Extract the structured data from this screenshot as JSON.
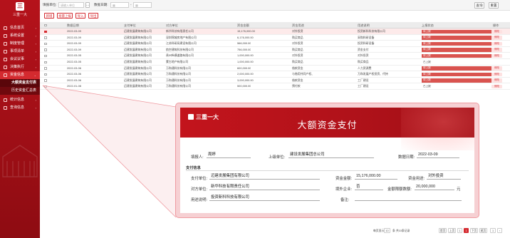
{
  "app": {
    "logo_mark": "三",
    "logo_text": "三重一大"
  },
  "sidebar": {
    "items": [
      {
        "label": "信息首页",
        "icon": "home-icon"
      },
      {
        "label": "系统设置",
        "icon": "settings-icon"
      },
      {
        "label": "制度管理",
        "icon": "document-icon"
      },
      {
        "label": "事项清单",
        "icon": "list-icon"
      },
      {
        "label": "会议议事",
        "icon": "meeting-icon"
      },
      {
        "label": "决策执行",
        "icon": "execute-icon"
      },
      {
        "label": "资金信息",
        "icon": "money-icon"
      }
    ],
    "subitems": [
      {
        "label": "大额资金支付表"
      },
      {
        "label": "历史资金汇总表"
      }
    ],
    "items_after": [
      {
        "label": "统计信息",
        "icon": "chart-icon"
      },
      {
        "label": "查询信息",
        "icon": "query-icon"
      }
    ]
  },
  "search": {
    "org_label": "填报单位:",
    "org_placeholder": "请输入单位",
    "date_label": "数据日期:",
    "date_separator": "-",
    "query_button": "查询",
    "reset_button": "重置"
  },
  "actions": {
    "add": "新增",
    "batch_submit": "批量上报",
    "import": "导入",
    "export": "导出"
  },
  "table": {
    "headers": [
      "",
      "数据日期",
      "支付单位",
      "对方单位",
      "资金金额",
      "资金用途",
      "用途说明",
      "上报状态",
      "操作"
    ],
    "rows": [
      {
        "date": "2022-03-09",
        "payer": "迈建发展建筑有限公司",
        "payee": "新华科技有限责任公司",
        "amount": "15,176,000.00",
        "purpose": "对外投资",
        "desc": "投资新科科技有限公司",
        "status": "待上报",
        "op": "修改",
        "selected": true
      },
      {
        "date": "2022-03-09",
        "payer": "迈建发展建筑有限公司",
        "payee": "深圳锦城房地产有限公司",
        "amount": "6,176,000.00",
        "purpose": "购买商品",
        "desc": "采购科研设备",
        "status": "待上报",
        "op": "修改",
        "selected": false
      },
      {
        "date": "2022-03-09",
        "payer": "迈建发展建筑有限公司",
        "payee": "江苏科研局建设有限公司",
        "amount": "566,000.00",
        "purpose": "对外投资",
        "desc": "投资科研设备",
        "status": "待上报",
        "op": "修改",
        "selected": false
      },
      {
        "date": "2022-03-09",
        "payer": "迈建发展建筑有限公司",
        "payee": "航空建筑科技有限公司",
        "amount": "756,000.00",
        "purpose": "购买商品",
        "desc": "资金支付",
        "status": "待上报",
        "op": "修改",
        "selected": false
      },
      {
        "date": "2022-03-05",
        "payer": "迈建发展建筑有限公司",
        "payee": "贵州纵横道路有限公司",
        "amount": "1,000,000.00",
        "purpose": "对外投资",
        "desc": "对外投资",
        "status": "待上报",
        "op": "修改",
        "selected": false
      },
      {
        "date": "2022-03-05",
        "payer": "迈建发展建筑有限公司",
        "payee": "蒙古地产有限公司",
        "amount": "1,000,000.00",
        "purpose": "购买商品",
        "desc": "购买商品",
        "status": "已上报",
        "op": "",
        "selected": false
      },
      {
        "date": "2022-03-06",
        "payer": "迈建发展建筑有限公司",
        "payee": "万和通科技有限公司",
        "amount": "600,000.00",
        "purpose": "借款资金",
        "desc": "人力资源费",
        "status": "待上报",
        "op": "修改",
        "selected": false
      },
      {
        "date": "2022-03-06",
        "payer": "迈建发展建筑有限公司",
        "payee": "万和通科技有限公司",
        "amount": "2,000,000.00",
        "purpose": "与借用共同产权、",
        "desc": "万和发展产权投资、代持",
        "status": "待上报",
        "op": "修改",
        "selected": false
      },
      {
        "date": "2022-03-06",
        "payer": "迈建发展建筑有限公司",
        "payee": "万和通科技有限公司",
        "amount": "3,000,000.00",
        "purpose": "借款资金",
        "desc": "工厂建设",
        "status": "待上报",
        "op": "修改",
        "selected": false
      },
      {
        "date": "2022-01-08",
        "payer": "迈建发展建筑有限公司",
        "payee": "万和通科技有限公司",
        "amount": "500,000.00",
        "purpose": "预付款",
        "desc": "工厂建设",
        "status": "已上报",
        "op": "修改",
        "selected": false
      }
    ]
  },
  "pager": {
    "prefix": "每页显示",
    "page_size": "10",
    "summary": "条 共10条记录",
    "first": "首页",
    "prev": "上页",
    "current": "1",
    "next": "下页",
    "last": "尾页",
    "goto": "1"
  },
  "card": {
    "logo_text": "三重一大",
    "title": "大额资金支付",
    "reporter_label": "填报人:",
    "reporter_value": "周婷",
    "parent_label": "上级单位:",
    "parent_value": "建设发展集团总公司",
    "date_label": "数据日期:",
    "date_value": "2022-03-09",
    "section_title": "支付信息",
    "payer_label": "支付单位:",
    "payer_value": "迈建发展集团有限公司",
    "amount_label": "资金金额:",
    "amount_value": "15,176,000.00",
    "purpose_label": "资金用途:",
    "purpose_value": "对外投资",
    "payee_label": "对方单位:",
    "payee_value": "新华科技有限责任公司",
    "affiliate_label": "境外企业:",
    "affiliate_value": "否",
    "limit_label": "金额限额数额:",
    "limit_value": "20,000,000",
    "limit_unit": "元",
    "desc_label": "用途说明:",
    "desc_value": "投资新科科技有限公司",
    "remark_label": "备注:",
    "remark_value": ""
  },
  "colors": {
    "brand_red": "#c3141c",
    "accent_red": "#d42a2f",
    "status_red": "#d9534f"
  }
}
